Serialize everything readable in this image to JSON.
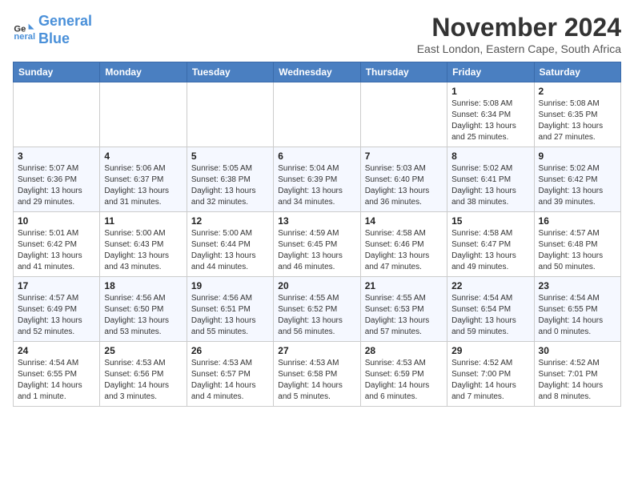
{
  "logo": {
    "line1": "General",
    "line2": "Blue"
  },
  "title": "November 2024",
  "location": "East London, Eastern Cape, South Africa",
  "weekdays": [
    "Sunday",
    "Monday",
    "Tuesday",
    "Wednesday",
    "Thursday",
    "Friday",
    "Saturday"
  ],
  "weeks": [
    [
      {
        "day": "",
        "info": ""
      },
      {
        "day": "",
        "info": ""
      },
      {
        "day": "",
        "info": ""
      },
      {
        "day": "",
        "info": ""
      },
      {
        "day": "",
        "info": ""
      },
      {
        "day": "1",
        "info": "Sunrise: 5:08 AM\nSunset: 6:34 PM\nDaylight: 13 hours\nand 25 minutes."
      },
      {
        "day": "2",
        "info": "Sunrise: 5:08 AM\nSunset: 6:35 PM\nDaylight: 13 hours\nand 27 minutes."
      }
    ],
    [
      {
        "day": "3",
        "info": "Sunrise: 5:07 AM\nSunset: 6:36 PM\nDaylight: 13 hours\nand 29 minutes."
      },
      {
        "day": "4",
        "info": "Sunrise: 5:06 AM\nSunset: 6:37 PM\nDaylight: 13 hours\nand 31 minutes."
      },
      {
        "day": "5",
        "info": "Sunrise: 5:05 AM\nSunset: 6:38 PM\nDaylight: 13 hours\nand 32 minutes."
      },
      {
        "day": "6",
        "info": "Sunrise: 5:04 AM\nSunset: 6:39 PM\nDaylight: 13 hours\nand 34 minutes."
      },
      {
        "day": "7",
        "info": "Sunrise: 5:03 AM\nSunset: 6:40 PM\nDaylight: 13 hours\nand 36 minutes."
      },
      {
        "day": "8",
        "info": "Sunrise: 5:02 AM\nSunset: 6:41 PM\nDaylight: 13 hours\nand 38 minutes."
      },
      {
        "day": "9",
        "info": "Sunrise: 5:02 AM\nSunset: 6:42 PM\nDaylight: 13 hours\nand 39 minutes."
      }
    ],
    [
      {
        "day": "10",
        "info": "Sunrise: 5:01 AM\nSunset: 6:42 PM\nDaylight: 13 hours\nand 41 minutes."
      },
      {
        "day": "11",
        "info": "Sunrise: 5:00 AM\nSunset: 6:43 PM\nDaylight: 13 hours\nand 43 minutes."
      },
      {
        "day": "12",
        "info": "Sunrise: 5:00 AM\nSunset: 6:44 PM\nDaylight: 13 hours\nand 44 minutes."
      },
      {
        "day": "13",
        "info": "Sunrise: 4:59 AM\nSunset: 6:45 PM\nDaylight: 13 hours\nand 46 minutes."
      },
      {
        "day": "14",
        "info": "Sunrise: 4:58 AM\nSunset: 6:46 PM\nDaylight: 13 hours\nand 47 minutes."
      },
      {
        "day": "15",
        "info": "Sunrise: 4:58 AM\nSunset: 6:47 PM\nDaylight: 13 hours\nand 49 minutes."
      },
      {
        "day": "16",
        "info": "Sunrise: 4:57 AM\nSunset: 6:48 PM\nDaylight: 13 hours\nand 50 minutes."
      }
    ],
    [
      {
        "day": "17",
        "info": "Sunrise: 4:57 AM\nSunset: 6:49 PM\nDaylight: 13 hours\nand 52 minutes."
      },
      {
        "day": "18",
        "info": "Sunrise: 4:56 AM\nSunset: 6:50 PM\nDaylight: 13 hours\nand 53 minutes."
      },
      {
        "day": "19",
        "info": "Sunrise: 4:56 AM\nSunset: 6:51 PM\nDaylight: 13 hours\nand 55 minutes."
      },
      {
        "day": "20",
        "info": "Sunrise: 4:55 AM\nSunset: 6:52 PM\nDaylight: 13 hours\nand 56 minutes."
      },
      {
        "day": "21",
        "info": "Sunrise: 4:55 AM\nSunset: 6:53 PM\nDaylight: 13 hours\nand 57 minutes."
      },
      {
        "day": "22",
        "info": "Sunrise: 4:54 AM\nSunset: 6:54 PM\nDaylight: 13 hours\nand 59 minutes."
      },
      {
        "day": "23",
        "info": "Sunrise: 4:54 AM\nSunset: 6:55 PM\nDaylight: 14 hours\nand 0 minutes."
      }
    ],
    [
      {
        "day": "24",
        "info": "Sunrise: 4:54 AM\nSunset: 6:55 PM\nDaylight: 14 hours\nand 1 minute."
      },
      {
        "day": "25",
        "info": "Sunrise: 4:53 AM\nSunset: 6:56 PM\nDaylight: 14 hours\nand 3 minutes."
      },
      {
        "day": "26",
        "info": "Sunrise: 4:53 AM\nSunset: 6:57 PM\nDaylight: 14 hours\nand 4 minutes."
      },
      {
        "day": "27",
        "info": "Sunrise: 4:53 AM\nSunset: 6:58 PM\nDaylight: 14 hours\nand 5 minutes."
      },
      {
        "day": "28",
        "info": "Sunrise: 4:53 AM\nSunset: 6:59 PM\nDaylight: 14 hours\nand 6 minutes."
      },
      {
        "day": "29",
        "info": "Sunrise: 4:52 AM\nSunset: 7:00 PM\nDaylight: 14 hours\nand 7 minutes."
      },
      {
        "day": "30",
        "info": "Sunrise: 4:52 AM\nSunset: 7:01 PM\nDaylight: 14 hours\nand 8 minutes."
      }
    ]
  ]
}
